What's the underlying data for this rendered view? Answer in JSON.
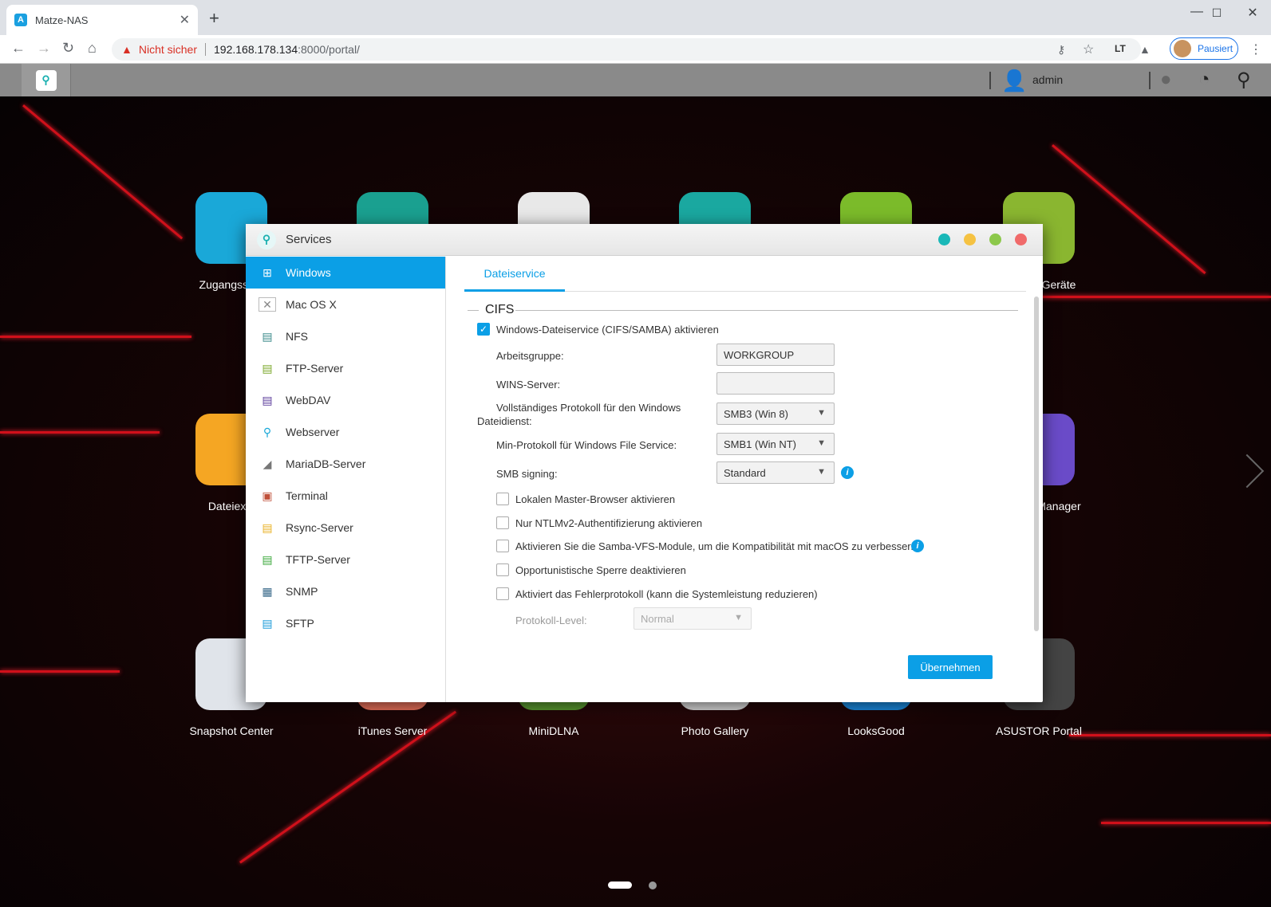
{
  "browser": {
    "tab_title": "Matze-NAS",
    "tab_favicon": "A",
    "new_tab": "+",
    "minimize": "—",
    "maximize": "☐",
    "close": "✕",
    "back": "←",
    "forward": "→",
    "reload": "↻",
    "home": "⌂",
    "not_secure": "Nicht sicher",
    "url_host": "192.168.178.134",
    "url_rest": ":8000/portal/",
    "profile_status": "Pausiert"
  },
  "taskbar": {
    "username": "admin"
  },
  "desktop": {
    "apps": [
      {
        "label": "Zugangssteu",
        "color": "#1aa8d8"
      },
      {
        "label": "",
        "color": "#1aa090"
      },
      {
        "label": "",
        "color": "#e8e8e8"
      },
      {
        "label": "",
        "color": "#1aa8a0"
      },
      {
        "label": "",
        "color": "#7bbb2a"
      },
      {
        "label": "Geräte",
        "color": "#8ab630"
      },
      {
        "label": "Dateiexpl",
        "color": "#f5a623"
      },
      {
        "label": "Manager",
        "color": "#6a4bc8"
      },
      {
        "label": "Snapshot Center",
        "color": "#e0e4ea"
      },
      {
        "label": "iTunes Server",
        "color": "#e8705a"
      },
      {
        "label": "MiniDLNA",
        "color": "#5a9a30"
      },
      {
        "label": "Photo Gallery",
        "color": "#d8d8d8"
      },
      {
        "label": "LooksGood",
        "color": "#1a8ae0"
      },
      {
        "label": "ASUSTOR Portal",
        "color": "#444444"
      }
    ]
  },
  "window": {
    "title": "Services",
    "dots": [
      "#1ab8b8",
      "#f5c242",
      "#8cc84b",
      "#f06a6a"
    ],
    "sidebar": [
      {
        "label": "Windows",
        "icon": "windows-icon",
        "active": true
      },
      {
        "label": "Mac OS X",
        "icon": "apple-icon"
      },
      {
        "label": "NFS",
        "icon": "nfs-icon"
      },
      {
        "label": "FTP-Server",
        "icon": "ftp-icon"
      },
      {
        "label": "WebDAV",
        "icon": "webdav-icon"
      },
      {
        "label": "Webserver",
        "icon": "webserver-icon"
      },
      {
        "label": "MariaDB-Server",
        "icon": "mariadb-icon"
      },
      {
        "label": "Terminal",
        "icon": "terminal-icon"
      },
      {
        "label": "Rsync-Server",
        "icon": "rsync-icon"
      },
      {
        "label": "TFTP-Server",
        "icon": "tftp-icon"
      },
      {
        "label": "SNMP",
        "icon": "snmp-icon"
      },
      {
        "label": "SFTP",
        "icon": "sftp-icon"
      }
    ],
    "tab": "Dateiservice",
    "section": "CIFS",
    "enable_label": "Windows-Dateiservice (CIFS/SAMBA) aktivieren",
    "workgroup_label": "Arbeitsgruppe:",
    "workgroup_value": "WORKGROUP",
    "wins_label": "WINS-Server:",
    "wins_value": "",
    "protocol_label_1": "Vollständiges Protokoll für den Windows",
    "protocol_label_2": "Dateidienst:",
    "protocol_value": "SMB3 (Win 8)",
    "min_protocol_label": "Min-Protokoll für Windows File Service:",
    "min_protocol_value": "SMB1 (Win NT)",
    "signing_label": "SMB signing:",
    "signing_value": "Standard",
    "options": [
      "Lokalen Master-Browser aktivieren",
      "Nur NTLMv2-Authentifizierung aktivieren",
      "Aktivieren Sie die Samba-VFS-Module, um die Kompatibilität mit macOS zu verbessern.",
      "Opportunistische Sperre deaktivieren",
      "Aktiviert das Fehlerprotokoll (kann die Systemleistung reduzieren)"
    ],
    "log_level_label": "Protokoll-Level:",
    "log_level_value": "Normal",
    "apply": "Übernehmen"
  }
}
